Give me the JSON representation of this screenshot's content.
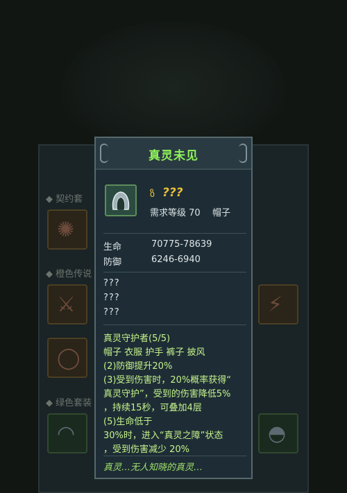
{
  "background": {
    "sections": [
      "契约套",
      "橙色传说",
      "绿色套装"
    ]
  },
  "tooltip": {
    "title": "真灵未见",
    "item_name": "???",
    "requirement": "需求等级 70",
    "slot_type": "帽子",
    "stats": [
      {
        "label": "生命",
        "value": "70775-78639"
      },
      {
        "label": "防御",
        "value": "6246-6940"
      }
    ],
    "unknown_lines": [
      "???",
      "???",
      "???"
    ],
    "set_lines": [
      "真灵守护者(5/5)",
      "帽子 衣服 护手 裤子 披风",
      "(2)防御提升20%",
      "(3)受到伤害时，20%概率获得“",
      "真灵守护”，受到的伤害降低5%",
      "，持续15秒，可叠加4层",
      "(5)生命低于",
      "30%时，进入“真灵之障”状态",
      "，受到伤害减少 20%"
    ],
    "flavor": "真灵…无人知晓的真灵…",
    "colors": {
      "title": "#8ff25a",
      "item_name": "#e8c03a",
      "set_text": "#c5f38c",
      "panel": "#1e2d35"
    },
    "icons": {
      "item": "hood-icon",
      "name_prefix": "key-icon"
    }
  }
}
